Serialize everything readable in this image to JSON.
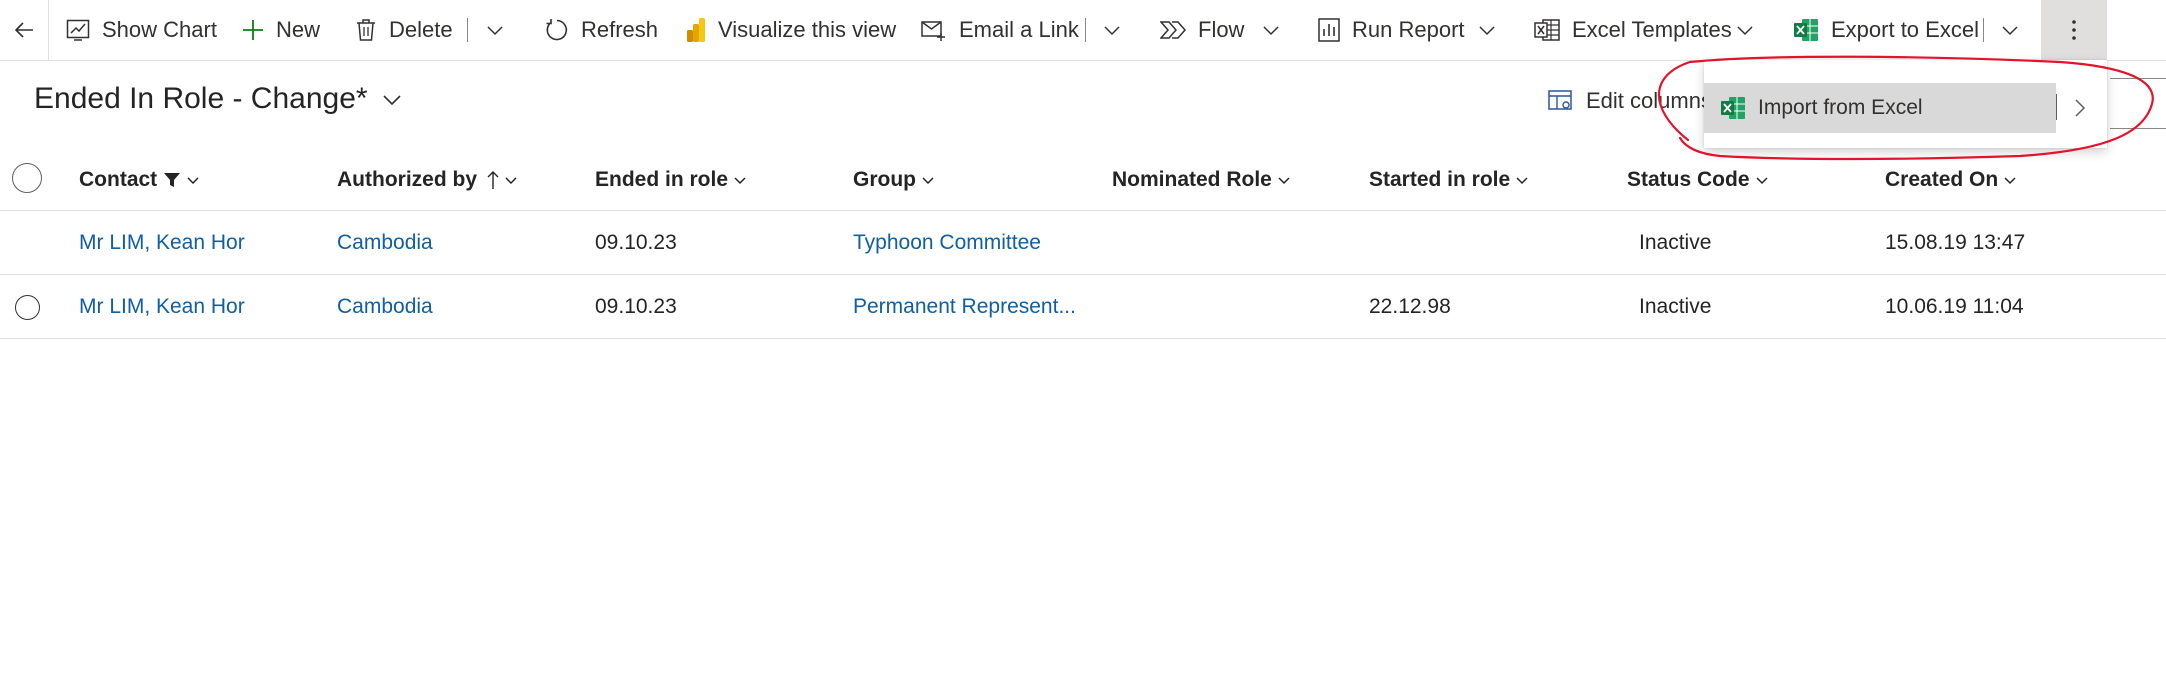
{
  "toolbar": {
    "show_chart": "Show Chart",
    "new": "New",
    "delete": "Delete",
    "refresh": "Refresh",
    "visualize": "Visualize this view",
    "email_link": "Email a Link",
    "flow": "Flow",
    "run_report": "Run Report",
    "excel_templates": "Excel Templates",
    "export_excel": "Export to Excel"
  },
  "view": {
    "title": "Ended In Role - Change*",
    "edit_columns": "Edit columns"
  },
  "menu": {
    "import_excel": "Import from Excel"
  },
  "grid": {
    "columns": [
      "Contact",
      "Authorized by",
      "Ended in role",
      "Group",
      "Nominated Role",
      "Started in role",
      "Status Code",
      "Created On"
    ],
    "rows": [
      {
        "contact": "Mr LIM, Kean Hor",
        "authorized_by": "Cambodia",
        "ended_in_role": "09.10.23",
        "group": "Typhoon Committee",
        "nominated_role": "",
        "started_in_role": "",
        "status_code": "Inactive",
        "created_on": "15.08.19 13:47"
      },
      {
        "contact": "Mr LIM, Kean Hor",
        "authorized_by": "Cambodia",
        "ended_in_role": "09.10.23",
        "group": "Permanent Represent...",
        "nominated_role": "",
        "started_in_role": "22.12.98",
        "status_code": "Inactive",
        "created_on": "10.06.19 11:04"
      }
    ]
  },
  "colors": {
    "link": "#115ea3",
    "excel_green": "#107c41",
    "powerbi_yellow": "#f2c811",
    "new_green": "#107c10",
    "annotation_red": "#e3132c",
    "menu_highlight": "#d9d9d9"
  },
  "icons": [
    "back-arrow-icon",
    "chart-icon",
    "plus-icon",
    "trash-icon",
    "chevron-down-icon",
    "refresh-icon",
    "powerbi-icon",
    "email-link-icon",
    "flow-icon",
    "report-icon",
    "excel-template-icon",
    "excel-icon",
    "more-vertical-icon",
    "edit-columns-icon",
    "filter-icon",
    "sort-up-icon",
    "chevron-right-icon"
  ]
}
